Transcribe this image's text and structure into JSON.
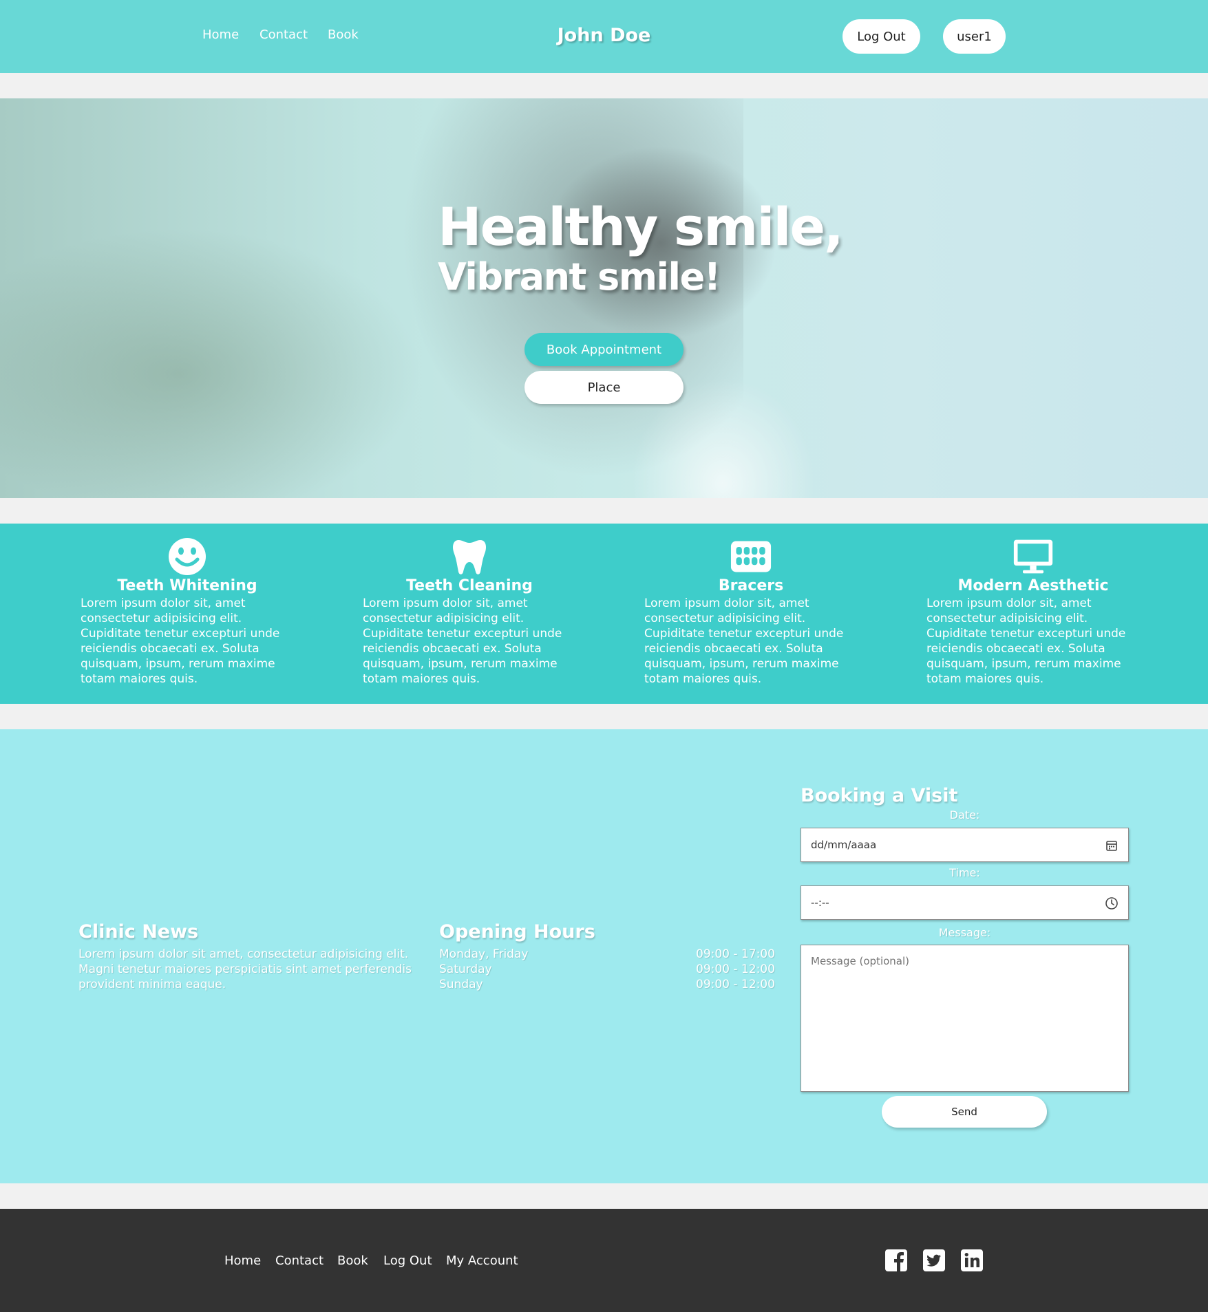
{
  "header": {
    "nav": [
      "Home",
      "Contact",
      "Book"
    ],
    "brand": "John Doe",
    "logout_label": "Log Out",
    "user_label": "user1"
  },
  "hero": {
    "title": "Healthy smile,",
    "subtitle": "Vibrant smile!",
    "book_label": "Book Appointment",
    "place_label": "Place"
  },
  "services": [
    {
      "icon": "smile-icon",
      "title": "Teeth Whitening",
      "text": "Lorem ipsum dolor sit, amet consectetur adipisicing elit. Cupiditate tenetur excepturi unde reiciendis obcaecati ex. Soluta quisquam, ipsum, rerum maxime totam maiores quis."
    },
    {
      "icon": "tooth-icon",
      "title": "Teeth Cleaning",
      "text": "Lorem ipsum dolor sit, amet consectetur adipisicing elit. Cupiditate tenetur excepturi unde reiciendis obcaecati ex. Soluta quisquam, ipsum, rerum maxime totam maiores quis."
    },
    {
      "icon": "teeth-icon",
      "title": "Bracers",
      "text": "Lorem ipsum dolor sit, amet consectetur adipisicing elit. Cupiditate tenetur excepturi unde reiciendis obcaecati ex. Soluta quisquam, ipsum, rerum maxime totam maiores quis."
    },
    {
      "icon": "monitor-icon",
      "title": "Modern Aesthetic",
      "text": "Lorem ipsum dolor sit, amet consectetur adipisicing elit. Cupiditate tenetur excepturi unde reiciendis obcaecati ex. Soluta quisquam, ipsum, rerum maxime totam maiores quis."
    }
  ],
  "news": {
    "title": "Clinic News",
    "text": "Lorem ipsum dolor sit amet, consectetur adipisicing elit. Magni tenetur maiores perspiciatis sint amet perferendis provident minima eaque."
  },
  "hours": {
    "title": "Opening Hours",
    "rows": [
      {
        "day": "Monday, Friday",
        "time": "09:00 - 17:00"
      },
      {
        "day": "Saturday",
        "time": "09:00 - 12:00"
      },
      {
        "day": "Sunday",
        "time": "09:00 - 12:00"
      }
    ]
  },
  "booking": {
    "title": "Booking a Visit",
    "date_label": "Date:",
    "date_value": "dd/mm/aaaa",
    "time_label": "Time:",
    "time_value": "--:--",
    "message_label": "Message:",
    "message_placeholder": "Message (optional)",
    "send_label": "Send"
  },
  "footer": {
    "links": [
      "Home",
      "Contact",
      "Book",
      "Log Out",
      "My Account"
    ],
    "social": [
      "facebook-icon",
      "twitter-icon",
      "linkedin-icon"
    ]
  },
  "colors": {
    "header": "#68d8d6",
    "services": "#3ecdca",
    "info": "#9eeaee",
    "footer": "#333333",
    "accent_button": "#3fccc9"
  }
}
